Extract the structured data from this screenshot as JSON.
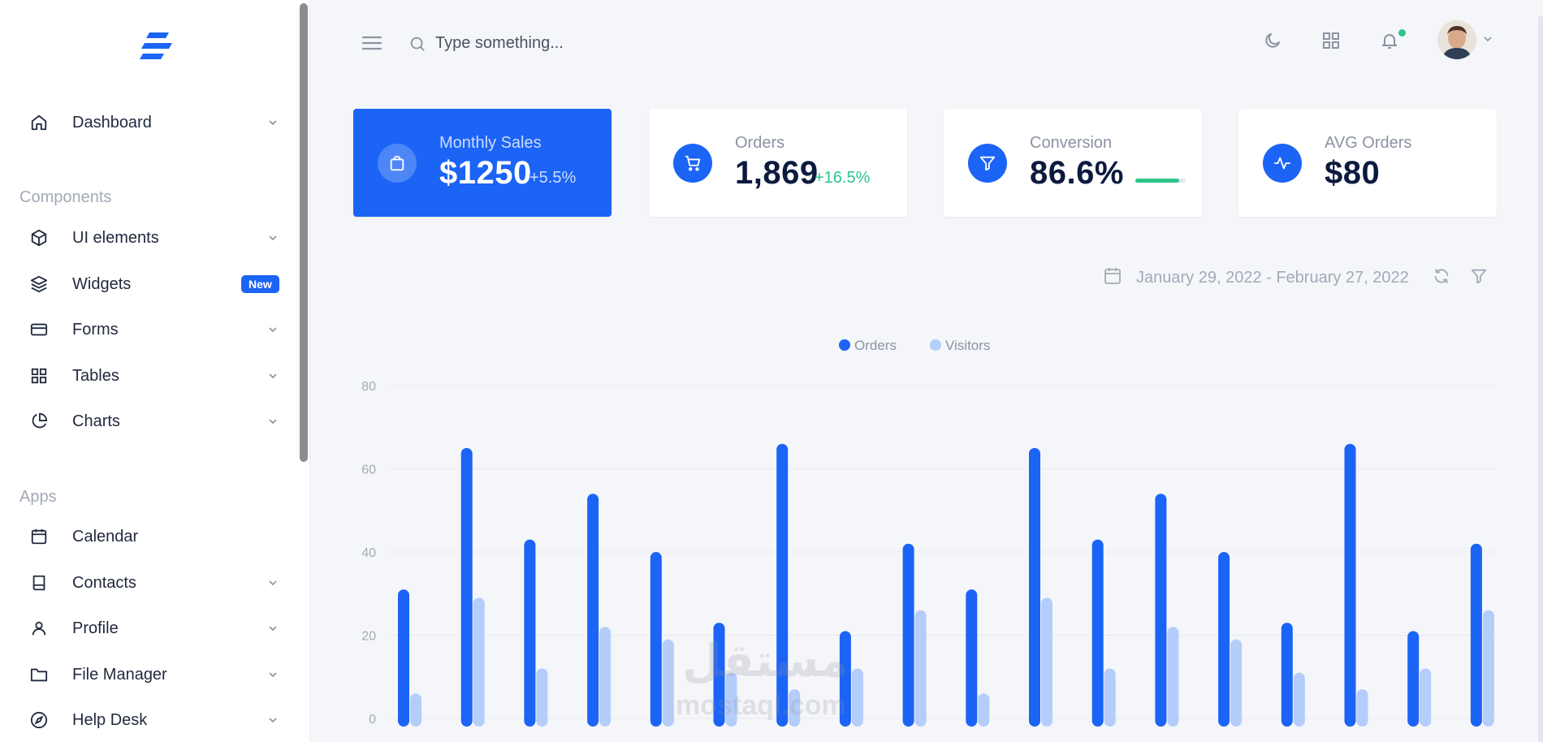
{
  "sidebar": {
    "items": [
      {
        "label": "Dashboard",
        "icon": "home-icon",
        "has_chevron": true
      },
      {
        "label": "UI elements",
        "icon": "cube-icon",
        "has_chevron": true
      },
      {
        "label": "Widgets",
        "icon": "layers-icon",
        "badge": "New"
      },
      {
        "label": "Forms",
        "icon": "credit-card-icon",
        "has_chevron": true
      },
      {
        "label": "Tables",
        "icon": "grid-icon",
        "has_chevron": true
      },
      {
        "label": "Charts",
        "icon": "pie-chart-icon",
        "has_chevron": true
      },
      {
        "label": "Calendar",
        "icon": "calendar-icon",
        "has_chevron": false
      },
      {
        "label": "Contacts",
        "icon": "book-icon",
        "has_chevron": true
      },
      {
        "label": "Profile",
        "icon": "user-icon",
        "has_chevron": true
      },
      {
        "label": "File Manager",
        "icon": "folder-icon",
        "has_chevron": true
      },
      {
        "label": "Help Desk",
        "icon": "life-buoy-icon",
        "has_chevron": true
      }
    ],
    "sections": {
      "components": "Components",
      "apps": "Apps"
    }
  },
  "header": {
    "search_placeholder": "Type something...",
    "icons": [
      "menu-icon",
      "search-icon",
      "moon-icon",
      "apps-grid-icon",
      "bell-icon",
      "avatar",
      "chevron-down-icon"
    ]
  },
  "cards": [
    {
      "title": "Monthly Sales",
      "value": "$1250",
      "delta": "+5.5%",
      "icon": "shopping-bag-icon"
    },
    {
      "title": "Orders",
      "value": "1,869",
      "delta": "+16.5%",
      "icon": "shopping-cart-icon"
    },
    {
      "title": "Conversion",
      "value": "86.6%",
      "progress": 0.866,
      "icon": "filter-icon"
    },
    {
      "title": "AVG Orders",
      "value": "$80",
      "icon": "activity-icon"
    }
  ],
  "date_range": "January 29, 2022 - February 27, 2022",
  "watermark": {
    "arabic": "مستقل",
    "latin": "mostaql.com"
  },
  "colors": {
    "primary": "#1b64f5",
    "secondary": "#b4cdfb",
    "success": "#2ec58b",
    "muted": "#a3a9b8"
  },
  "chart_data": {
    "type": "bar",
    "legend": [
      "Orders",
      "Visitors"
    ],
    "legend_position": "top-center",
    "ylim": [
      0,
      80
    ],
    "yticks": [
      0,
      20,
      40,
      60,
      80
    ],
    "grid": true,
    "series": [
      {
        "name": "Orders",
        "color": "#1b64f5",
        "values": [
          31,
          65,
          43,
          54,
          40,
          23,
          66,
          21,
          42,
          31,
          65,
          43,
          54,
          40,
          23,
          66,
          21,
          42
        ]
      },
      {
        "name": "Visitors",
        "color": "#b4cdfb",
        "values": [
          6,
          29,
          12,
          22,
          19,
          11,
          7,
          12,
          26,
          6,
          29,
          12,
          22,
          19,
          11,
          7,
          12,
          26
        ]
      }
    ]
  }
}
